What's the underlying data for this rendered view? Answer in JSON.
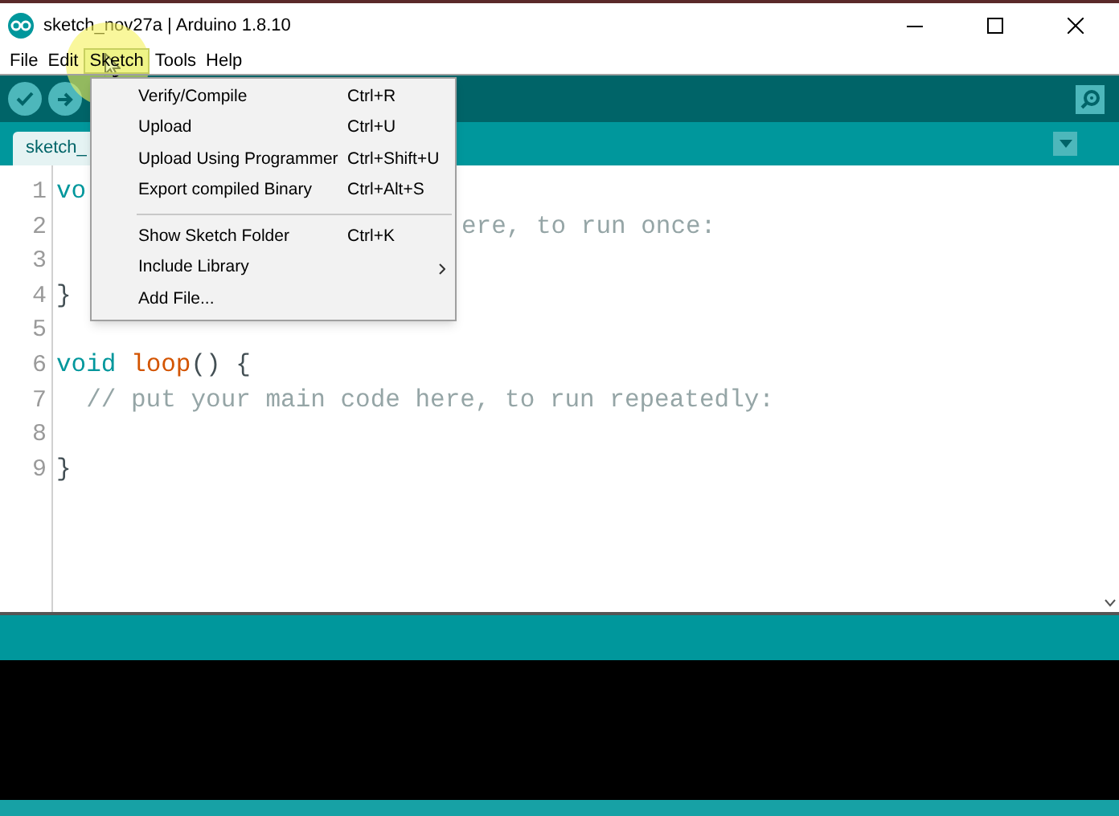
{
  "window": {
    "title": "sketch_nov27a | Arduino 1.8.10"
  },
  "menu_bar": [
    {
      "label": "File",
      "selected": false
    },
    {
      "label": "Edit",
      "selected": false
    },
    {
      "label": "Sketch",
      "selected": true
    },
    {
      "label": "Tools",
      "selected": false
    },
    {
      "label": "Help",
      "selected": false
    }
  ],
  "sketch_menu": [
    {
      "label": "Verify/Compile",
      "shortcut": "Ctrl+R",
      "kind": "item"
    },
    {
      "label": "Upload",
      "shortcut": "Ctrl+U",
      "kind": "item"
    },
    {
      "label": "Upload Using Programmer",
      "shortcut": "Ctrl+Shift+U",
      "kind": "item"
    },
    {
      "label": "Export compiled Binary",
      "shortcut": "Ctrl+Alt+S",
      "kind": "item"
    },
    {
      "kind": "separator"
    },
    {
      "label": "Show Sketch Folder",
      "shortcut": "Ctrl+K",
      "kind": "item"
    },
    {
      "label": "Include Library",
      "kind": "submenu"
    },
    {
      "label": "Add File...",
      "kind": "item"
    }
  ],
  "tabs": [
    {
      "label": "sketch_",
      "selected": true
    }
  ],
  "editor": {
    "lines": [
      {
        "number": "1",
        "kind": "normal",
        "tokens": [
          {
            "kind": "keyword",
            "text": "vo"
          }
        ]
      },
      {
        "number": "2",
        "kind": "covered",
        "tokens": [
          {
            "kind": "comment",
            "text": "ere, to run once:"
          }
        ]
      },
      {
        "number": "3",
        "kind": "normal"
      },
      {
        "number": "4",
        "kind": "normal",
        "tokens": [
          {
            "kind": "plain",
            "text": "}"
          }
        ]
      },
      {
        "number": "5",
        "kind": "normal"
      },
      {
        "number": "6",
        "kind": "normal",
        "tokens": [
          {
            "kind": "keyword",
            "text": "void"
          },
          {
            "kind": "function",
            "text": "loop"
          },
          {
            "kind": "plain",
            "text": "() {"
          }
        ]
      },
      {
        "number": "7",
        "kind": "normal",
        "tokens": [
          {
            "kind": "comment",
            "text": "  // put your main code here, to run repeatedly:"
          }
        ]
      },
      {
        "number": "8",
        "kind": "normal"
      },
      {
        "number": "9",
        "kind": "normal",
        "tokens": [
          {
            "kind": "plain",
            "text": "}"
          }
        ]
      }
    ]
  }
}
